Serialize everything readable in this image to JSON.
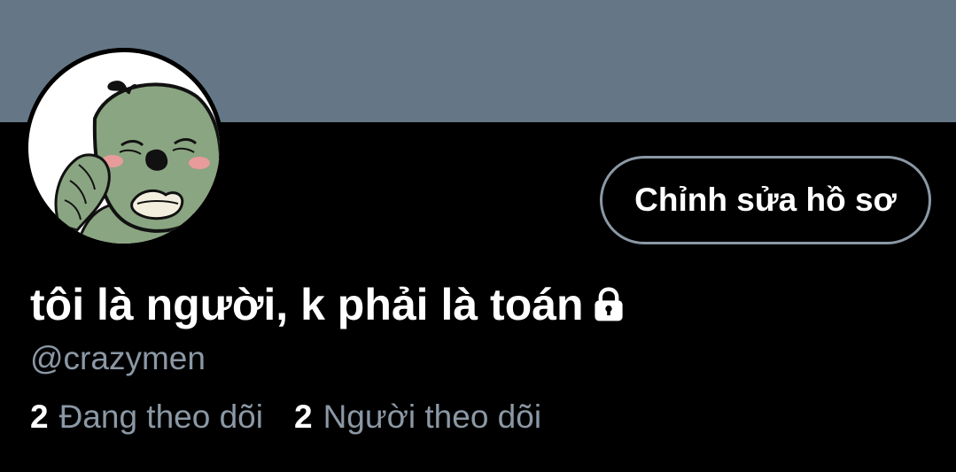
{
  "profile": {
    "display_name": "tôi là người, k phải là toán",
    "handle": "@crazymen",
    "edit_button_label": "Chỉnh sửa hồ sơ",
    "protected_icon": "lock-icon",
    "avatar_icon": "cartoon-character-avatar"
  },
  "stats": {
    "following_count": "2",
    "following_label": "Đang theo dõi",
    "followers_count": "2",
    "followers_label": "Người theo dõi"
  },
  "colors": {
    "banner": "#657786",
    "background": "#000000",
    "text_primary": "#ffffff",
    "text_secondary": "#8b98a5",
    "button_border": "#8b98a5",
    "avatar_skin": "#8aa581"
  }
}
